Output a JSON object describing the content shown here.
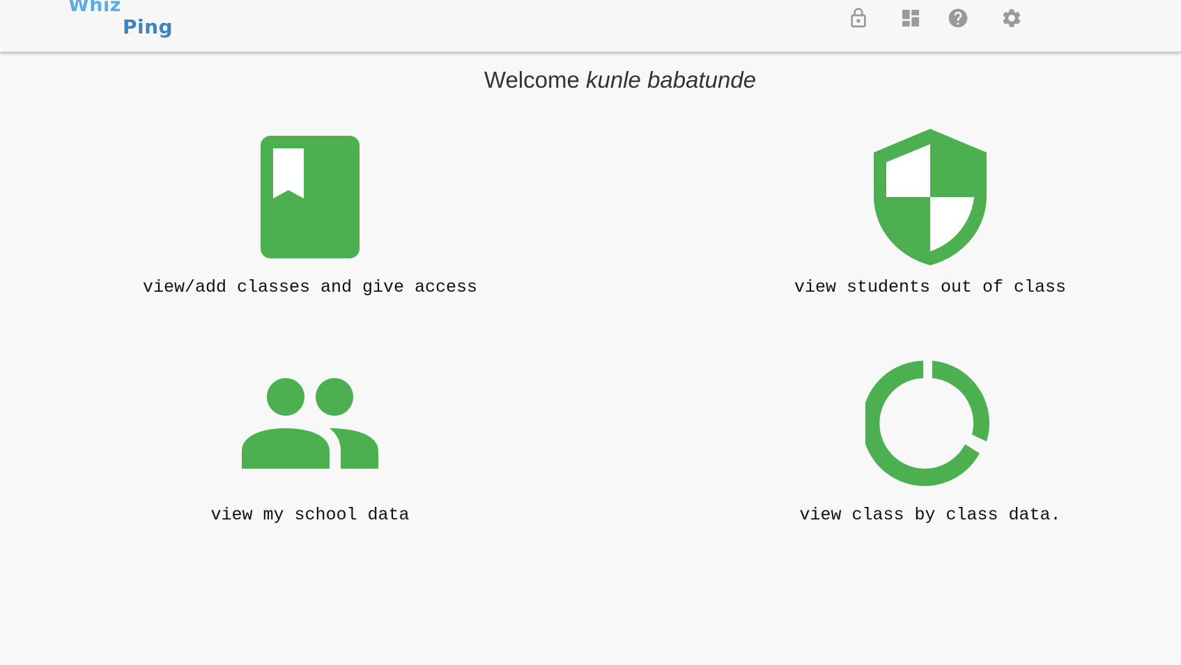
{
  "header": {
    "logo_line1": "Whiz",
    "logo_line2": "Ping",
    "icons": [
      "lock-icon",
      "dashboard-icon",
      "help-icon",
      "settings-icon"
    ]
  },
  "welcome": {
    "prefix": "Welcome",
    "user": "kunle babatunde"
  },
  "tiles": [
    {
      "label": "view/add classes and give access",
      "icon": "book-icon"
    },
    {
      "label": "view students out of class",
      "icon": "shield-icon"
    },
    {
      "label": "view my school data",
      "icon": "people-icon"
    },
    {
      "label": "view class by class data.",
      "icon": "donut-chart-icon"
    }
  ],
  "colors": {
    "accent": "#4caf50",
    "nav_icon": "#9a9a9a",
    "logo_light": "#5aaee6",
    "logo_dark": "#3d84bd"
  }
}
